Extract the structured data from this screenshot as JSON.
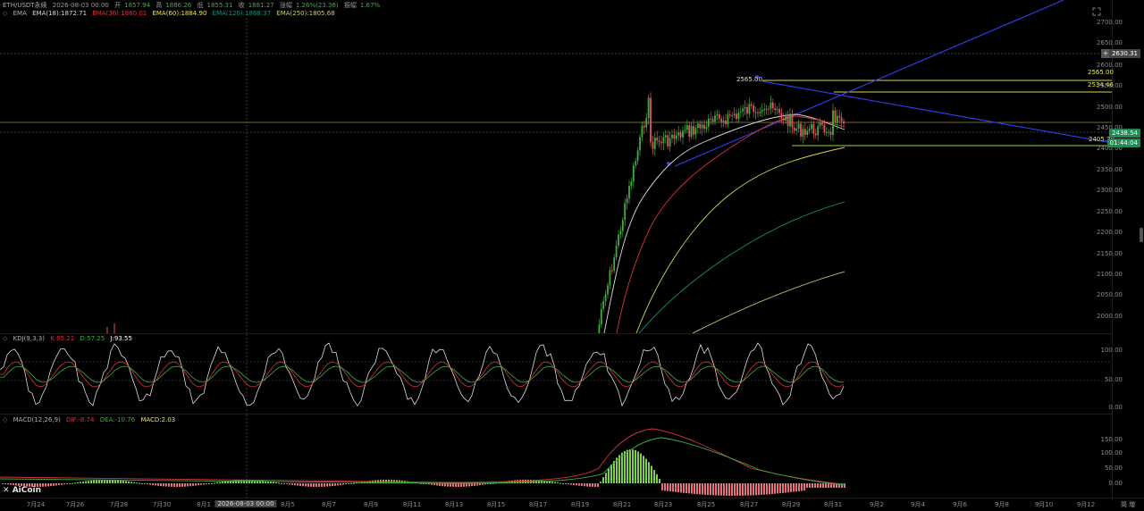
{
  "header": {
    "symbol": "ETH/USDT永续",
    "datetime": "2026-08-03 00:00",
    "open_label": "开",
    "open": "1857.94",
    "high_label": "高",
    "high": "1886.26",
    "low_label": "低",
    "low": "1855.31",
    "close_label": "收",
    "close": "1881.27",
    "change_label": "涨幅",
    "change": "1.26%(23.36)",
    "amp_label": "振幅",
    "amp": "1.67%"
  },
  "ema_legend": {
    "name": "EMA",
    "ema18": "EMA(18):1872.71",
    "ema36": "EMA(36):1860.01",
    "ema60": "EMA(60):1884.90",
    "ema120": "EMA(120):1868.37",
    "ema250": "EMA(250):1805.68"
  },
  "kdj_legend": {
    "name": "KDJ(9,3,3)",
    "k": "K:65.21",
    "d": "D:57.25",
    "j": "J:93.55"
  },
  "macd_legend": {
    "name": "MACD(12,26,9)",
    "dif": "DIF:-8.74",
    "dea": "DEA:-10.76",
    "macd": "MACD:2.03"
  },
  "price_axis": [
    "2700.00",
    "2650.00",
    "2600.00",
    "2550.00",
    "2500.00",
    "2450.00",
    "2400.00",
    "2350.00",
    "2300.00",
    "2250.00",
    "2200.00",
    "2150.00",
    "2100.00",
    "2050.00",
    "2000.00"
  ],
  "kdj_axis": [
    "100.00",
    "50.00",
    "0.00"
  ],
  "macd_axis": [
    "150.00",
    "100.00",
    "50.00",
    "0.00"
  ],
  "x_axis": [
    "7月24",
    "7月26",
    "7月28",
    "7月30",
    "8月1",
    "2026-08-03 00:00",
    "8月5",
    "8月7",
    "8月9",
    "8月11",
    "8月13",
    "8月15",
    "8月17",
    "8月19",
    "8月21",
    "8月23",
    "8月25",
    "8月27",
    "8月29",
    "8月31",
    "9月2",
    "9月4",
    "9月6",
    "9月8",
    "9月10",
    "9月12"
  ],
  "tags": {
    "crosshair_price": "2630.31",
    "current_price": "2438.54",
    "countdown": "01:44:04",
    "line_2565": "2565.00",
    "line_2534": "2534.46",
    "line_2405": "2405.20",
    "annot_2565": "2565.00"
  },
  "branding": {
    "logo": "AiCoin"
  },
  "corner": {
    "a": "简",
    "b": "增"
  },
  "colors": {
    "up": "#3fae3f",
    "down": "#e05563",
    "accent": "#2aa56a",
    "yellow": "#d9d34a",
    "blue": "#2e3de6"
  }
}
